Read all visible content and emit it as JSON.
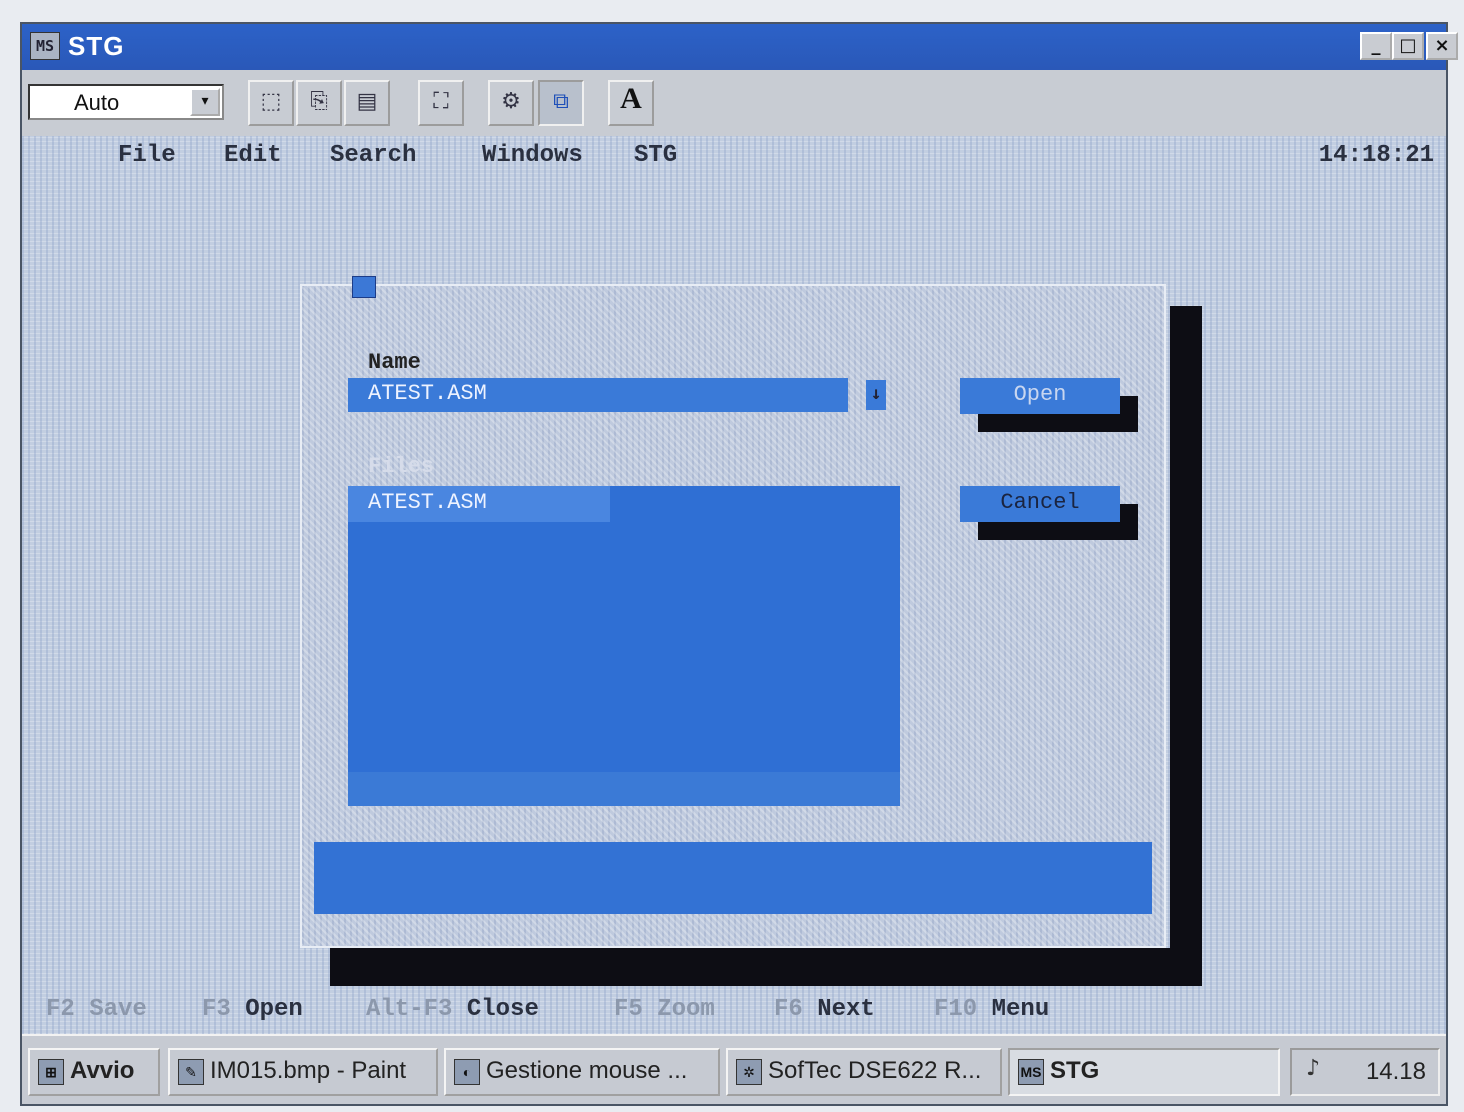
{
  "window": {
    "title": "STG",
    "controls": {
      "minimize": "_",
      "maximize": "□",
      "close": "×"
    }
  },
  "toolbar": {
    "font_select": {
      "value": "Auto",
      "arrow": "▾"
    },
    "tools": [
      {
        "icon": "mark-icon",
        "glyph": "⬚"
      },
      {
        "icon": "copy-icon",
        "glyph": "⎘"
      },
      {
        "icon": "paste-icon",
        "glyph": "▤"
      },
      {
        "icon": "fullscreen-icon",
        "glyph": "⛶"
      },
      {
        "icon": "properties-icon",
        "glyph": "⚙"
      },
      {
        "icon": "background-icon",
        "glyph": "⧉"
      },
      {
        "icon": "font-icon",
        "glyph": "A"
      }
    ]
  },
  "menu": {
    "items": [
      "File",
      "Edit",
      "Search",
      "Windows",
      "STG"
    ],
    "clock": "14:18:21"
  },
  "dialog": {
    "name_label": "Name",
    "name_value": "ATEST.ASM",
    "files_label": "Files",
    "files": [
      "ATEST.ASM"
    ],
    "open_label": "Open",
    "cancel_label": "Cancel"
  },
  "fkeys": [
    {
      "key": "F2",
      "label": "Save",
      "dim": true
    },
    {
      "key": "F3",
      "label": "Open",
      "dim": false
    },
    {
      "key": "Alt-F3",
      "label": "Close",
      "dim": false
    },
    {
      "key": "F5",
      "label": "Zoom",
      "dim": true
    },
    {
      "key": "F6",
      "label": "Next",
      "dim": false
    },
    {
      "key": "F10",
      "label": "Menu",
      "dim": false
    }
  ],
  "taskbar": {
    "start_label": "Avvio",
    "tasks": [
      {
        "label": "IM015.bmp - Paint",
        "icon": "paint-icon",
        "active": false
      },
      {
        "label": "Gestione mouse ...",
        "icon": "mouse-icon",
        "active": false
      },
      {
        "label": "SofTec DSE622 R...",
        "icon": "softec-icon",
        "active": false
      },
      {
        "label": "STG",
        "icon": "msdos-icon",
        "active": true
      }
    ],
    "time": "14.18"
  }
}
